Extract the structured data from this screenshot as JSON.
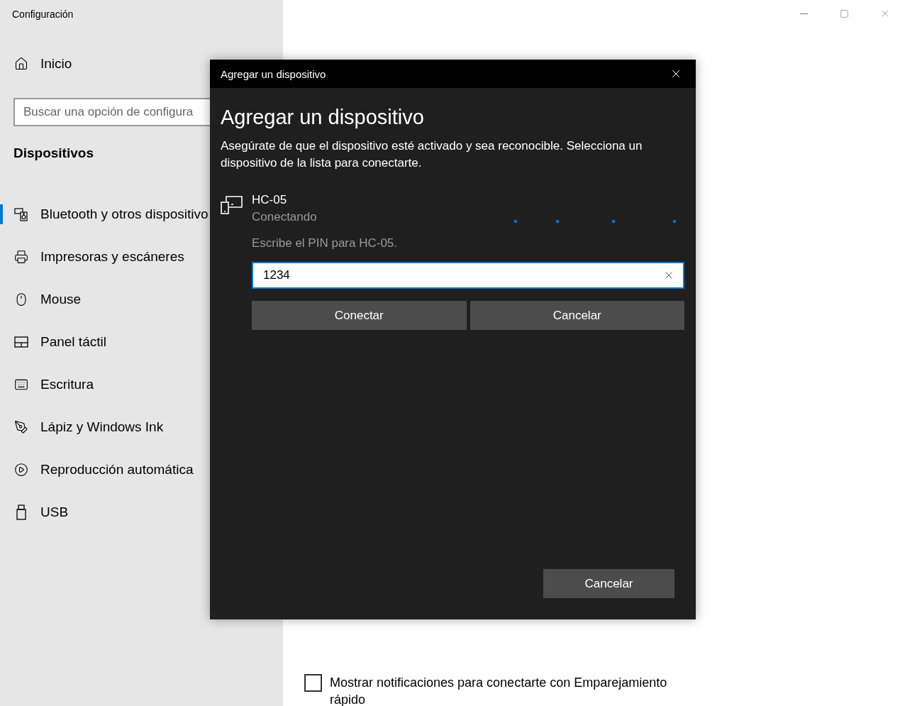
{
  "window": {
    "title": "Configuración"
  },
  "sidebar": {
    "home": {
      "label": "Inicio"
    },
    "search": {
      "placeholder": "Buscar una opción de configura"
    },
    "section": "Dispositivos",
    "items": [
      {
        "kind": "bluetooth",
        "label": "Bluetooth y otros dispositivo",
        "selected": true
      },
      {
        "kind": "printer",
        "label": "Impresoras y escáneres",
        "selected": false
      },
      {
        "kind": "mouse",
        "label": "Mouse",
        "selected": false
      },
      {
        "kind": "touchpad",
        "label": "Panel táctil",
        "selected": false
      },
      {
        "kind": "keyboard",
        "label": "Escritura",
        "selected": false
      },
      {
        "kind": "pen",
        "label": "Lápiz y Windows Ink",
        "selected": false
      },
      {
        "kind": "autoplay",
        "label": "Reproducción automática",
        "selected": false
      },
      {
        "kind": "usb",
        "label": "USB",
        "selected": false
      }
    ]
  },
  "main": {
    "checkbox": {
      "label": "Mostrar notificaciones para conectarte con Emparejamiento rápido",
      "checked": false
    }
  },
  "dialog": {
    "title": "Agregar un dispositivo",
    "heading": "Agregar un dispositivo",
    "description": "Asegúrate de que el dispositivo esté activado y sea reconocible. Selecciona un dispositivo de la lista para conectarte.",
    "device": {
      "name": "HC-05",
      "status": "Conectando"
    },
    "pin_prompt": "Escribe el PIN para HC-05.",
    "pin_field": {
      "value": "1234"
    },
    "buttons": [
      "Conectar",
      "Cancelar"
    ],
    "footer_button": "Cancelar"
  }
}
